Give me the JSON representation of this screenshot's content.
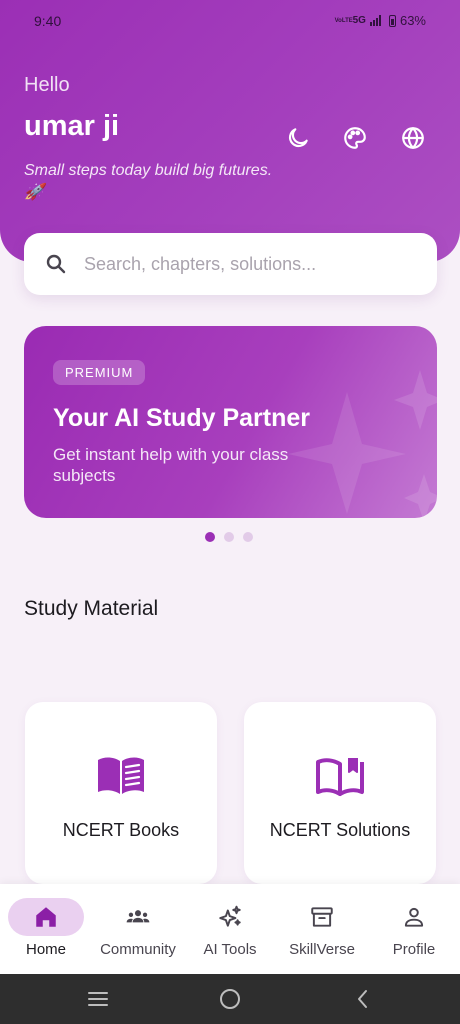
{
  "status_bar": {
    "time": "9:40",
    "network": "5G",
    "network_sub": "VoLTE",
    "battery": "63%"
  },
  "header": {
    "greeting": "Hello",
    "username": "umar ji",
    "tagline": "Small steps today build big futures. 🚀",
    "icons": [
      "moon-icon",
      "palette-icon",
      "globe-icon"
    ]
  },
  "search": {
    "placeholder": "Search, chapters, solutions..."
  },
  "banner": {
    "badge": "PREMIUM",
    "title": "Your AI Study Partner",
    "subtitle": "Get instant help with your class subjects",
    "page_index": 0,
    "page_count": 3
  },
  "study_material": {
    "title": "Study Material",
    "cards": [
      {
        "label": "NCERT Books",
        "icon": "open-book-icon"
      },
      {
        "label": "NCERT Solutions",
        "icon": "book-solutions-icon"
      }
    ]
  },
  "bottom_nav": {
    "items": [
      {
        "label": "Home",
        "icon": "home-icon",
        "active": true
      },
      {
        "label": "Community",
        "icon": "community-icon",
        "active": false
      },
      {
        "label": "AI Tools",
        "icon": "sparkles-icon",
        "active": false
      },
      {
        "label": "SkillVerse",
        "icon": "archive-icon",
        "active": false
      },
      {
        "label": "Profile",
        "icon": "person-icon",
        "active": false
      }
    ]
  },
  "colors": {
    "primary": "#9b2fb5",
    "header_gradient_end": "#ac4fc2",
    "background": "#f7f0f8",
    "active_pill": "#ead0f0",
    "nav_bar": "#2e2e2e"
  }
}
